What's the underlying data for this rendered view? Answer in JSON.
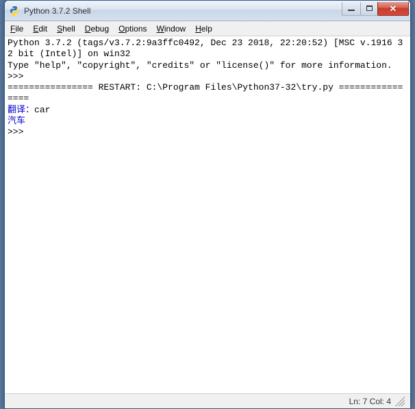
{
  "window": {
    "title": "Python 3.7.2 Shell"
  },
  "menu": {
    "file": "File",
    "edit": "Edit",
    "shell": "Shell",
    "debug": "Debug",
    "options": "Options",
    "window": "Window",
    "help": "Help"
  },
  "shell": {
    "banner1": "Python 3.7.2 (tags/v3.7.2:9a3ffc0492, Dec 23 2018, 22:20:52) [MSC v.1916 32 bit (Intel)] on win32",
    "banner2": "Type \"help\", \"copyright\", \"credits\" or \"license()\" for more information.",
    "prompt": ">>> ",
    "restart_line": "================ RESTART: C:\\Program Files\\Python37-32\\try.py ================",
    "prompt_label": "翻译：",
    "user_input": "car",
    "output": "汽车"
  },
  "status": {
    "position": "Ln: 7  Col: 4"
  }
}
